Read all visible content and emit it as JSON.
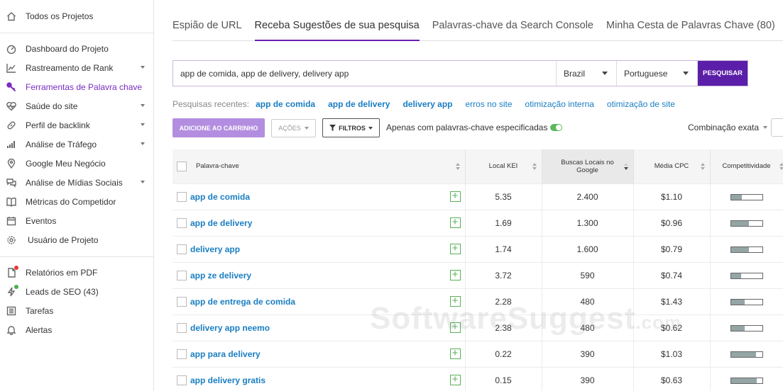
{
  "sidebar": {
    "top": {
      "label": "Todos os Projetos",
      "icon": "home-icon"
    },
    "items": [
      {
        "label": "Dashboard do Projeto",
        "icon": "dashboard-icon",
        "expand": false
      },
      {
        "label": "Rastreamento de Rank",
        "icon": "trend-chart-icon",
        "expand": true
      },
      {
        "label": "Ferramentas de Palavra chave",
        "icon": "key-icon",
        "expand": false,
        "active": true
      },
      {
        "label": "Saúde do site",
        "icon": "heartbeat-icon",
        "expand": true
      },
      {
        "label": "Perfil de backlink",
        "icon": "link-icon",
        "expand": true
      },
      {
        "label": "Análise de Tráfego",
        "icon": "bar-chart-icon",
        "expand": true
      },
      {
        "label": "Google Meu Negócio",
        "icon": "map-pin-icon",
        "expand": false
      },
      {
        "label": "Análise de Mídias Sociais",
        "icon": "chat-bubbles-icon",
        "expand": true
      },
      {
        "label": "Métricas do Competidor",
        "icon": "book-icon",
        "expand": false
      },
      {
        "label": "Eventos",
        "icon": "calendar-icon",
        "expand": false
      },
      {
        "label": "Usuário de Projeto",
        "icon": "gear-icon",
        "expand": false
      }
    ],
    "bottom": [
      {
        "label": "Relatórios em PDF",
        "icon": "pdf-icon",
        "dot": "#e53935"
      },
      {
        "label": "Leads de SEO (43)",
        "icon": "bolt-icon",
        "dot": "#4caf50"
      },
      {
        "label": "Tarefas",
        "icon": "list-icon"
      },
      {
        "label": "Alertas",
        "icon": "bell-icon"
      }
    ]
  },
  "tabs": [
    "Espião de URL",
    "Receba Sugestões de sua pesquisa",
    "Palavras-chave da Search Console",
    "Minha Cesta de Palavras Chave (80)"
  ],
  "active_tab": 1,
  "search": {
    "value": "app de comida, app de delivery, delivery app",
    "country": "Brazil",
    "language": "Portuguese",
    "button": "PESQUISAR"
  },
  "recent": {
    "label": "Pesquisas recentes:",
    "links": [
      {
        "text": "app de comida",
        "bold": true
      },
      {
        "text": "app de delivery",
        "bold": true
      },
      {
        "text": "delivery app",
        "bold": true
      },
      {
        "text": "erros no site",
        "bold": false
      },
      {
        "text": "otimização interna",
        "bold": false
      },
      {
        "text": "otimização de site",
        "bold": false
      }
    ]
  },
  "toolbar": {
    "cart": "ADICIONE AO CARRINHO",
    "actions": "AÇÕES",
    "filters": "FILTROS",
    "only_label": "Apenas com palavras-chave especificadas",
    "match": "Combinação exata"
  },
  "table": {
    "headers": {
      "keyword": "Palavra-chave",
      "kei": "Local KEI",
      "searches": "Buscas Locais no Google",
      "cpc": "Média CPC",
      "comp": "Competitividade"
    },
    "rows": [
      {
        "kw": "app de comida",
        "kei": "5.35",
        "searches": "2.400",
        "cpc": "$1.10",
        "comp": 0.35
      },
      {
        "kw": "app de delivery",
        "kei": "1.69",
        "searches": "1.300",
        "cpc": "$0.96",
        "comp": 0.58
      },
      {
        "kw": "delivery app",
        "kei": "1.74",
        "searches": "1.600",
        "cpc": "$0.79",
        "comp": 0.58
      },
      {
        "kw": "app ze delivery",
        "kei": "3.72",
        "searches": "590",
        "cpc": "$0.74",
        "comp": 0.33
      },
      {
        "kw": "app de entrega de comida",
        "kei": "2.28",
        "searches": "480",
        "cpc": "$1.43",
        "comp": 0.45
      },
      {
        "kw": "delivery app neemo",
        "kei": "2.38",
        "searches": "480",
        "cpc": "$0.62",
        "comp": 0.45
      },
      {
        "kw": "app para delivery",
        "kei": "0.22",
        "searches": "390",
        "cpc": "$1.03",
        "comp": 0.8
      },
      {
        "kw": "app delivery gratis",
        "kei": "0.15",
        "searches": "390",
        "cpc": "$0.63",
        "comp": 0.82
      }
    ]
  },
  "watermark": {
    "main": "SoftwareSuggest",
    "suffix": ".com"
  },
  "colors": {
    "accent": "#5a1ea8",
    "link": "#1a7ec2",
    "active_nav": "#7a2dc2",
    "plus": "#58b158"
  }
}
